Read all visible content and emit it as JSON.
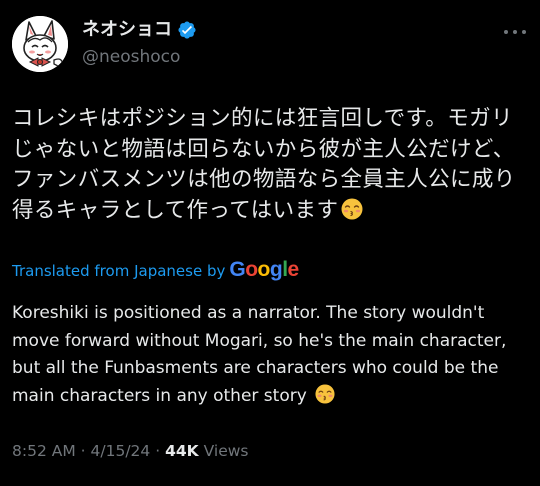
{
  "author": {
    "display_name": "ネオショコ",
    "handle": "@neoshoco",
    "verified": true,
    "avatar_icon": "fox-character-avatar"
  },
  "post": {
    "text": "コレシキはポジション的には狂言回しです。モガリ\nじゃないと物語は回らないから彼が主人公だけど、\nファンバスメンツは他の物語なら全員主人公に成り\n得るキャラとして作ってはいます",
    "emoji": "kissing-face-with-closed-eyes"
  },
  "translation": {
    "label": "Translated from Japanese by",
    "provider": "Google",
    "text": "Koreshiki is positioned as a narrator. The story wouldn't move forward without Mogari, so he's the main character, but all the Funbasments are characters who could be the main characters in any other story"
  },
  "meta": {
    "time": "8:52 AM",
    "date": "4/15/24",
    "separator": "·",
    "views_count": "44K",
    "views_label": "Views"
  },
  "colors": {
    "background": "#000000",
    "text": "#e7e9ea",
    "secondary": "#71767b",
    "accent": "#1d9bf0"
  }
}
